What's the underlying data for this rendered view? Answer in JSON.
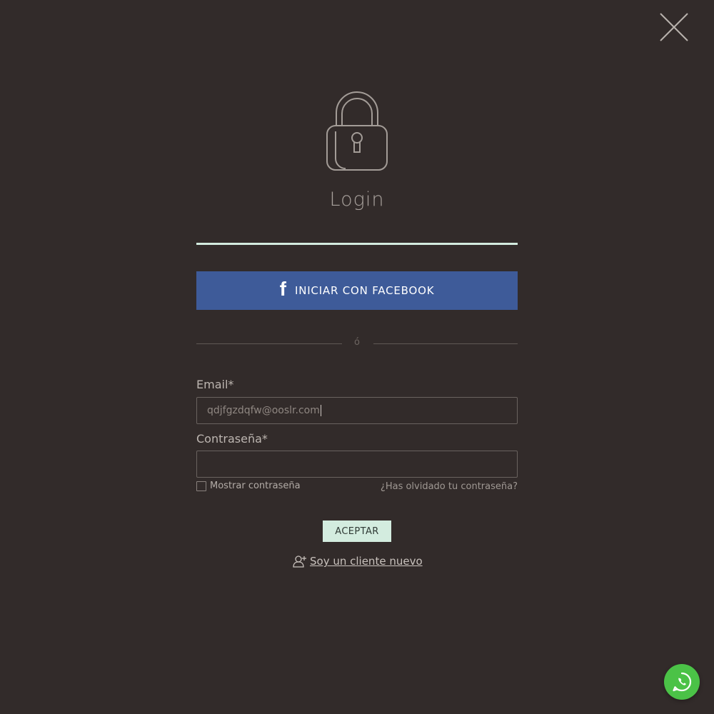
{
  "colors": {
    "background": "#322b2a",
    "accent": "#d3ecdf",
    "facebook": "#3e5b99",
    "whatsapp": "#4bc247"
  },
  "title": "Login",
  "facebook_button": {
    "label": "INICIAR CON FACEBOOK",
    "icon": "facebook-icon",
    "glyph": "f"
  },
  "divider_text": "ó",
  "form": {
    "email": {
      "label": "Email*",
      "value": "qdjfgzdqfw@ooslr.com"
    },
    "password": {
      "label": "Contraseña*",
      "value": ""
    },
    "show_password_label": "Mostrar contraseña",
    "show_password_checked": false,
    "forgot_password": "¿Has olvidado tu contraseña?",
    "submit_label": "ACEPTAR"
  },
  "new_client_link": "Soy un cliente nuevo",
  "icons": {
    "close": "close-icon",
    "lock": "lock-icon",
    "add_user": "add-user-icon",
    "whatsapp": "whatsapp-icon"
  }
}
